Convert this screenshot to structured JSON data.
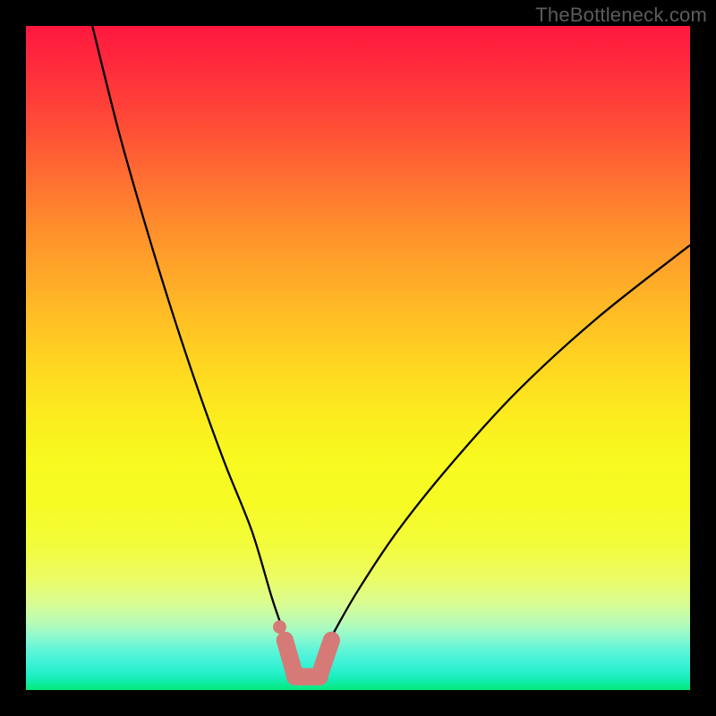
{
  "watermark": {
    "text": "TheBottleneck.com"
  },
  "colors": {
    "curve_stroke": "#000000",
    "marker_fill": "#d57a76",
    "gradient_top": "#ff183f",
    "gradient_bottom": "#07ea77"
  },
  "chart_data": {
    "type": "line",
    "title": "",
    "xlabel": "",
    "ylabel": "",
    "xlim": [
      0,
      100
    ],
    "ylim": [
      0,
      100
    ],
    "grid": false,
    "legend": false,
    "series": [
      {
        "name": "bottleneck-curve",
        "x": [
          10,
          14,
          18,
          22,
          26,
          30,
          34,
          37,
          39,
          40,
          41,
          42,
          43,
          44,
          46,
          50,
          56,
          64,
          74,
          86,
          100
        ],
        "y": [
          100,
          84,
          70,
          57,
          45,
          34,
          24,
          14,
          8,
          4,
          2,
          1,
          2,
          4,
          8,
          15,
          24,
          34,
          45,
          56,
          67
        ]
      }
    ],
    "markers": [
      {
        "name": "dot",
        "x": 38.2,
        "y": 9.5,
        "r": 1.0
      },
      {
        "name": "segment",
        "x": [
          39.0,
          40.5
        ],
        "y": [
          7.5,
          2.2
        ],
        "width": 2.6
      },
      {
        "name": "flat-bottom",
        "x": [
          40.5,
          44.2
        ],
        "y": [
          2.0,
          2.0
        ],
        "width": 2.6
      },
      {
        "name": "segment",
        "x": [
          44.2,
          46.0
        ],
        "y": [
          2.2,
          7.5
        ],
        "width": 2.6
      }
    ]
  }
}
